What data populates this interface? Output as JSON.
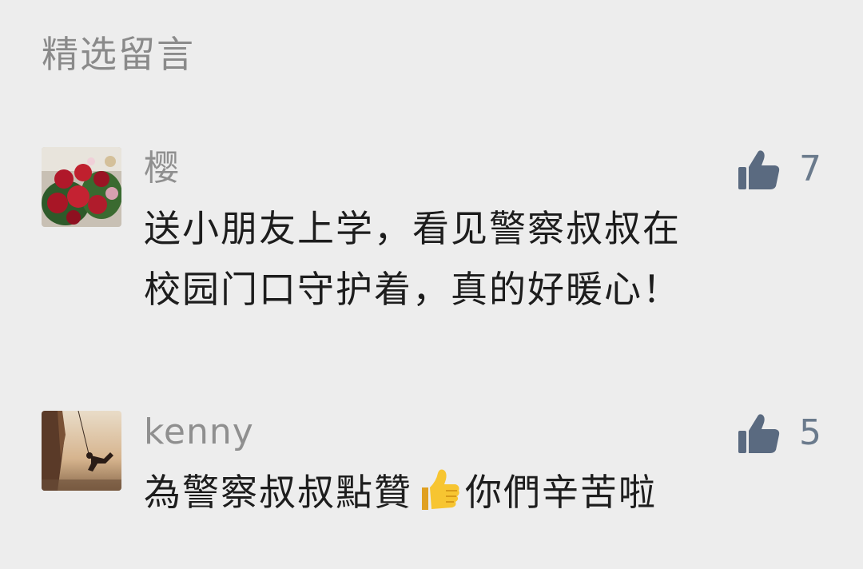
{
  "section": {
    "title": "精选留言"
  },
  "comments": [
    {
      "nickname": "樱",
      "likes": "7",
      "avatar": "roses-bouquet-avatar",
      "content_lines": [
        "送小朋友上学，看见警察叔叔在",
        "校园门口守护着，真的好暖心！"
      ]
    },
    {
      "nickname": "kenny",
      "likes": "5",
      "avatar": "climber-silhouette-avatar",
      "content_before_emoji": "為警察叔叔點贊",
      "emoji": "thumbs-up-emoji",
      "content_after_emoji": "你們辛苦啦"
    }
  ],
  "icons": {
    "like": "thumbs-up-icon"
  },
  "colors": {
    "background": "#ededed",
    "title": "#8a8a8a",
    "nickname": "#8f8f8f",
    "content": "#1d1d1d",
    "like_icon": "#5a6a80",
    "like_count": "#6a7a8c"
  }
}
